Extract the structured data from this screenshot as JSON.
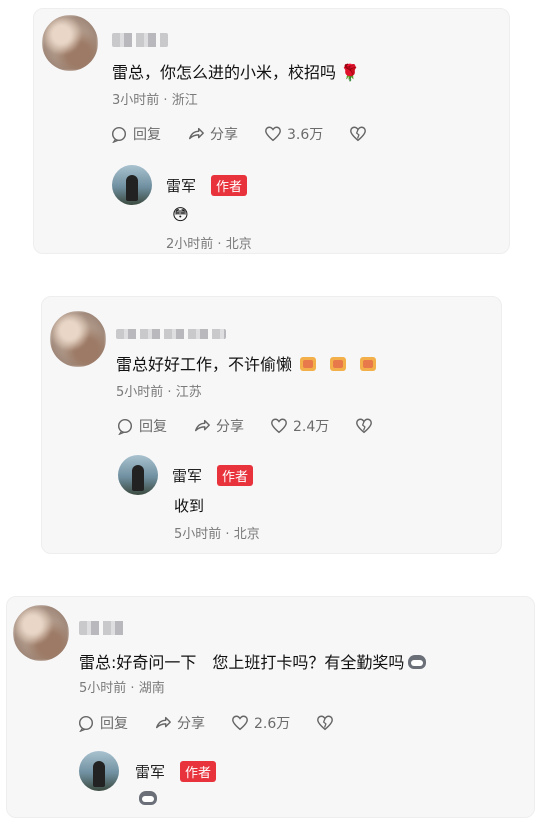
{
  "comments": [
    {
      "text": "雷总，你怎么进的小米，校招吗",
      "time": "3小时前",
      "location": "浙江",
      "reply_label": "回复",
      "share_label": "分享",
      "likes": "3.6万",
      "reply": {
        "name": "雷军",
        "badge": "作者",
        "text": "",
        "time": "2小时前",
        "location": "北京"
      }
    },
    {
      "text": "雷总好好工作，不许偷懒",
      "time": "5小时前",
      "location": "江苏",
      "reply_label": "回复",
      "share_label": "分享",
      "likes": "2.4万",
      "reply": {
        "name": "雷军",
        "badge": "作者",
        "text": "收到",
        "time": "5小时前",
        "location": "北京"
      }
    },
    {
      "text": "雷总:好奇问一下　您上班打卡吗？有全勤奖吗",
      "time": "5小时前",
      "location": "湖南",
      "reply_label": "回复",
      "share_label": "分享",
      "likes": "2.6万",
      "reply": {
        "name": "雷军",
        "badge": "作者",
        "text": ""
      }
    }
  ],
  "separator": "·",
  "colors": {
    "badge": "#e8323c",
    "card_bg": "#f7f7f8",
    "meta": "#7a7a7a"
  },
  "icons": [
    "reply-icon",
    "share-icon",
    "heart-icon",
    "broken-heart-icon",
    "rose-emoji",
    "gift-emoji",
    "cat-emoji",
    "shy-emoji"
  ]
}
